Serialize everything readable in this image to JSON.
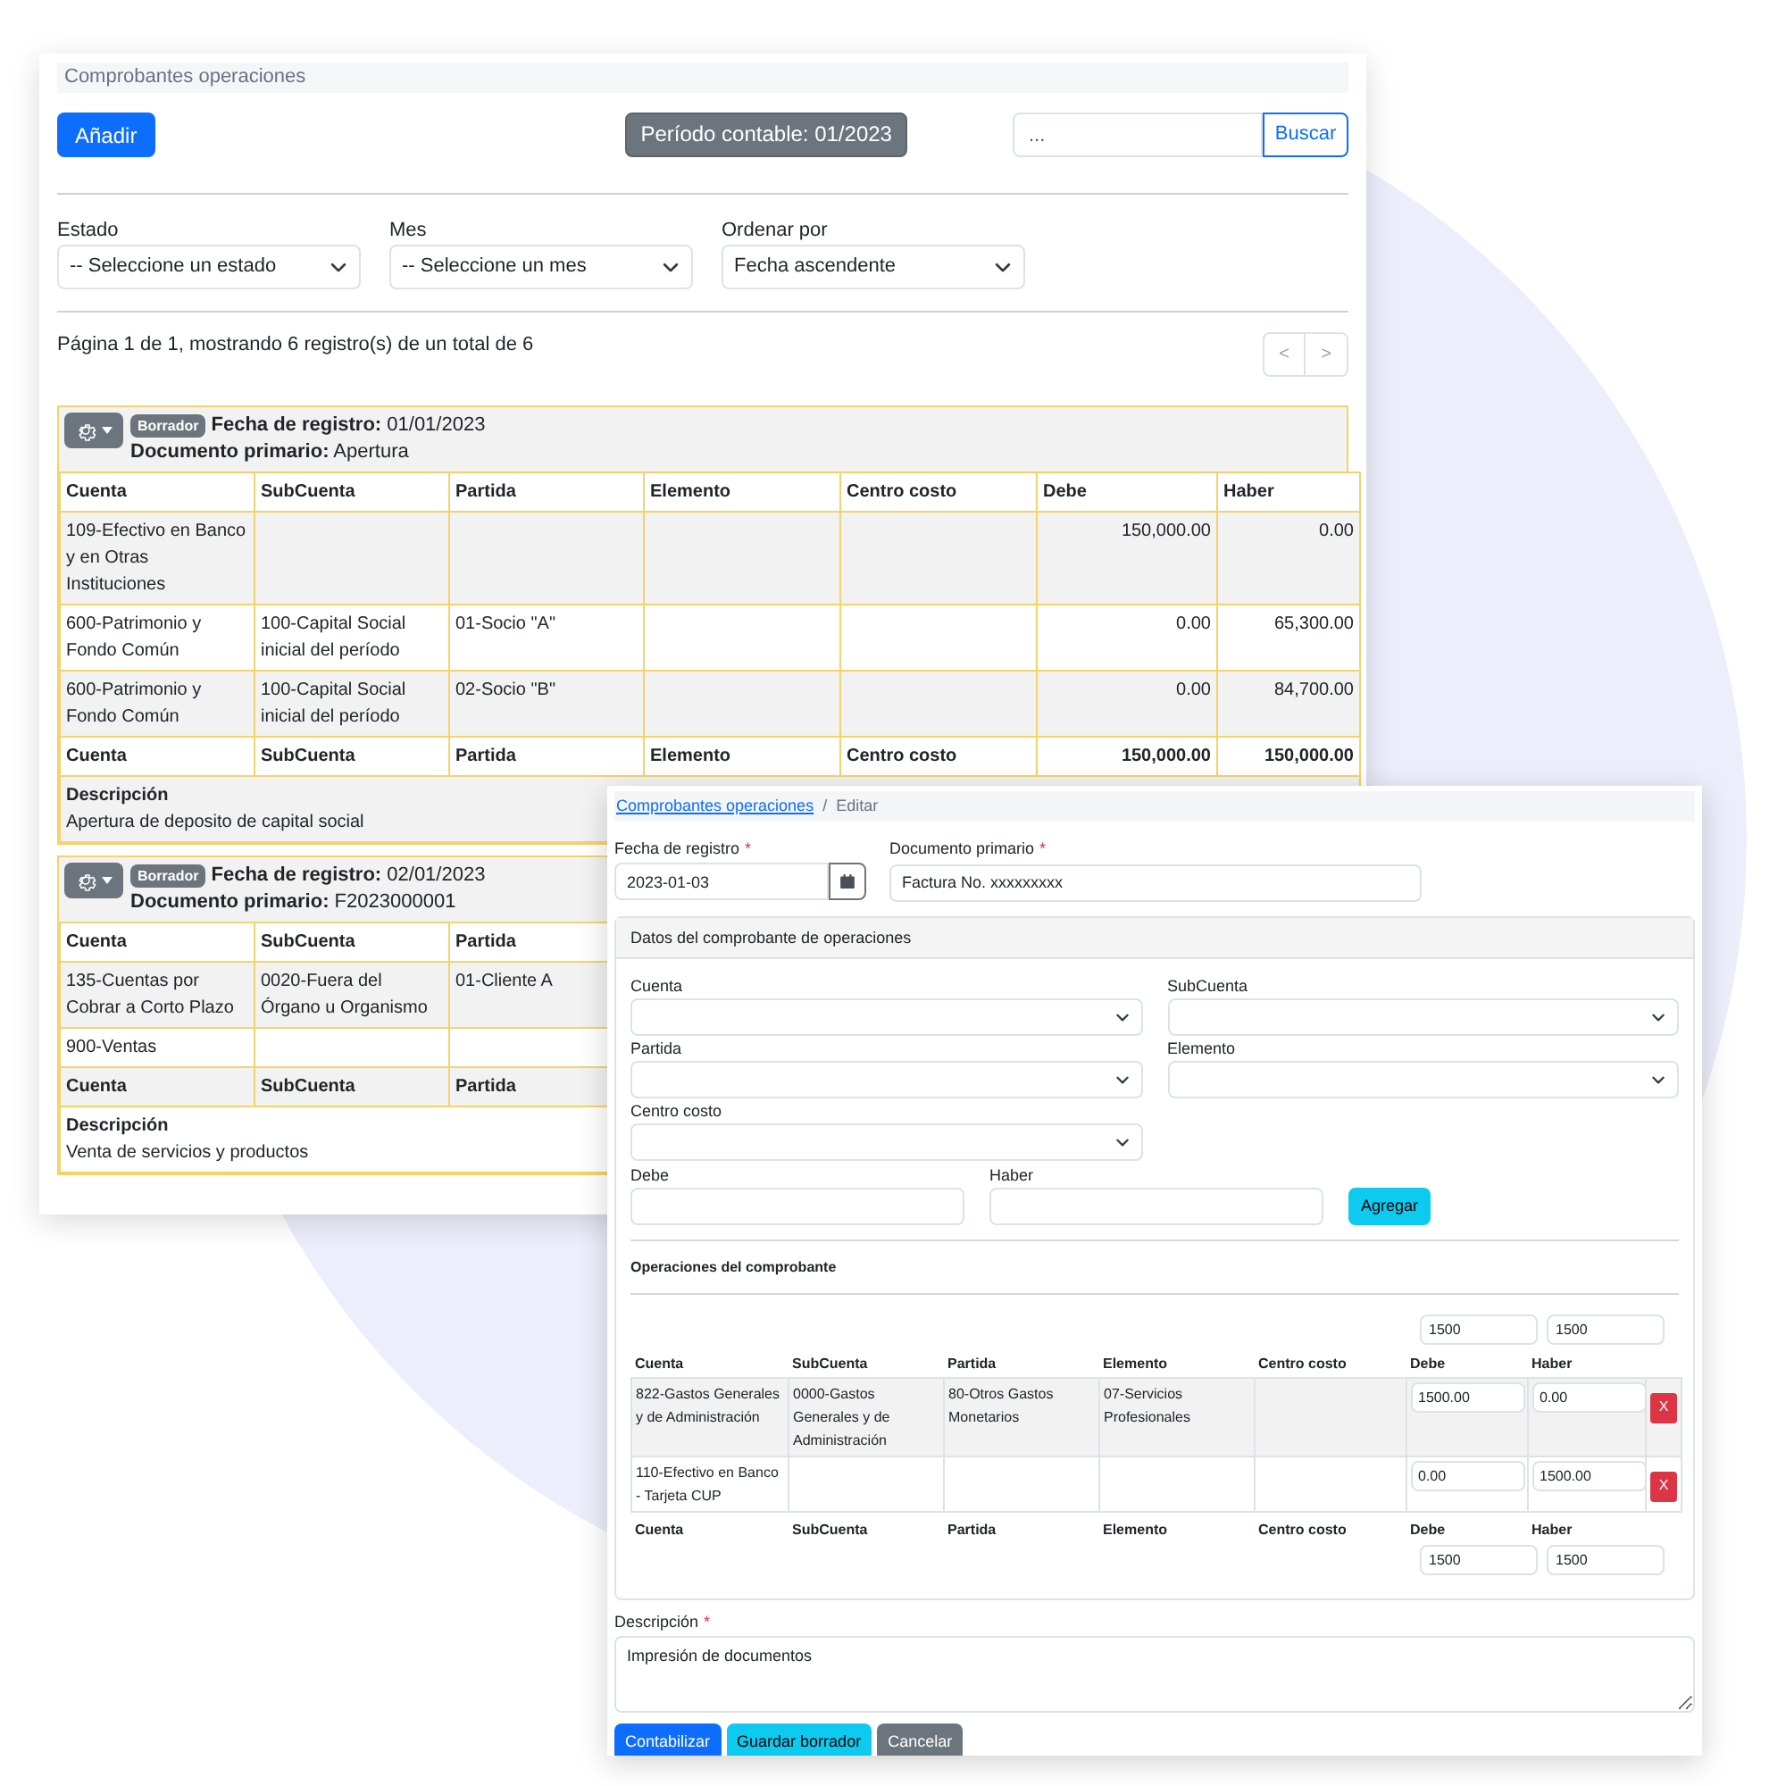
{
  "list_window": {
    "title": "Comprobantes operaciones",
    "add_button": "Añadir",
    "period_badge": "Período contable: 01/2023",
    "search": {
      "placeholder": "...",
      "button": "Buscar"
    },
    "filters": [
      {
        "label": "Estado",
        "value": "-- Seleccione un estado"
      },
      {
        "label": "Mes",
        "value": "-- Seleccione un mes"
      },
      {
        "label": "Ordenar por",
        "value": "Fecha ascendente"
      }
    ],
    "pagination": {
      "summary": "Página 1 de 1, mostrando 6 registro(s) de un total de 6",
      "prev": "<",
      "next": ">"
    },
    "vouchers": [
      {
        "status": "Borrador",
        "date_line": "**Fecha de registro:** 01/01/2023",
        "document_line": "**Documento primario:** Apertura",
        "columns": [
          "Cuenta",
          "SubCuenta",
          "Partida",
          "Elemento",
          "Centro costo",
          "Debe",
          "Haber"
        ],
        "rows": [
          [
            "109-Efectivo en Banco y en Otras Instituciones",
            null,
            null,
            null,
            null,
            "150,000.00",
            "0.00"
          ],
          [
            "600-Patrimonio y Fondo Común",
            "100-Capital Social inicial del período",
            "01-Socio \"A\"",
            null,
            null,
            "0.00",
            "65,300.00"
          ],
          [
            "600-Patrimonio y Fondo Común",
            "100-Capital Social inicial del período",
            "02-Socio \"B\"",
            null,
            null,
            "0.00",
            "84,700.00"
          ]
        ],
        "footer": [
          "Cuenta",
          "SubCuenta",
          "Partida",
          "Elemento",
          "Centro costo",
          "150,000.00",
          "150,000.00"
        ],
        "description_label": "Descripción",
        "description": "Apertura de deposito de capital social"
      },
      {
        "status": "Borrador",
        "date_line": "**Fecha de registro:** 02/01/2023",
        "document_line": "**Documento primario:** F2023000001",
        "columns": [
          "Cuenta",
          "SubCuenta",
          "Partida"
        ],
        "rows": [
          [
            "135-Cuentas por Cobrar a Corto Plazo",
            "0020-Fuera del Órgano u Organismo",
            "01-Cliente A"
          ],
          [
            "900-Ventas",
            null,
            null
          ]
        ],
        "footer": [
          "Cuenta",
          "SubCuenta",
          "Partida"
        ],
        "description_label": "Descripción",
        "description": "Venta de servicios y productos"
      }
    ]
  },
  "edit_window": {
    "breadcrumb": [
      {
        "label": "Comprobantes operaciones",
        "kind": "link"
      },
      {
        "label": "Editar",
        "kind": "current"
      }
    ],
    "breadcrumb_separator": "/",
    "date_field": {
      "label": "Fecha de registro",
      "required_mark": "*",
      "value": "2023-01-03"
    },
    "document_field": {
      "label": "Documento primario",
      "required_mark": "*",
      "value": "Factura No. xxxxxxxxx"
    },
    "data_card": {
      "title": "Datos del comprobante de operaciones",
      "selects": [
        "Cuenta",
        "SubCuenta",
        "Partida",
        "Elemento",
        "Centro costo"
      ],
      "amount_fields": [
        "Debe",
        "Haber"
      ],
      "add_button": "Agregar",
      "operations_title": "Operaciones del comprobante",
      "top_totals": [
        "1500",
        "1500"
      ],
      "columns": [
        "Cuenta",
        "SubCuenta",
        "Partida",
        "Elemento",
        "Centro costo",
        "Debe",
        "Haber"
      ],
      "rows": [
        {
          "cells": [
            "822-Gastos Generales y de Administración",
            "0000-Gastos Generales y de Administración",
            "80-Otros Gastos Monetarios",
            "07-Servicios Profesionales",
            null,
            "1500.00",
            "0.00"
          ],
          "remove": "X"
        },
        {
          "cells": [
            "110-Efectivo en Banco - Tarjeta CUP",
            null,
            null,
            null,
            null,
            "0.00",
            "1500.00"
          ],
          "remove": "X"
        }
      ],
      "footer": [
        "Cuenta",
        "SubCuenta",
        "Partida",
        "Elemento",
        "Centro costo",
        "Debe",
        "Haber"
      ],
      "bottom_totals": [
        "1500",
        "1500"
      ]
    },
    "description": {
      "label": "Descripción",
      "required_mark": "*",
      "value": "Impresión de documentos"
    },
    "buttons": [
      {
        "label": "Contabilizar",
        "kind": "primary"
      },
      {
        "label": "Guardar borrador",
        "kind": "info"
      },
      {
        "label": "Cancelar",
        "kind": "secondary"
      }
    ]
  }
}
